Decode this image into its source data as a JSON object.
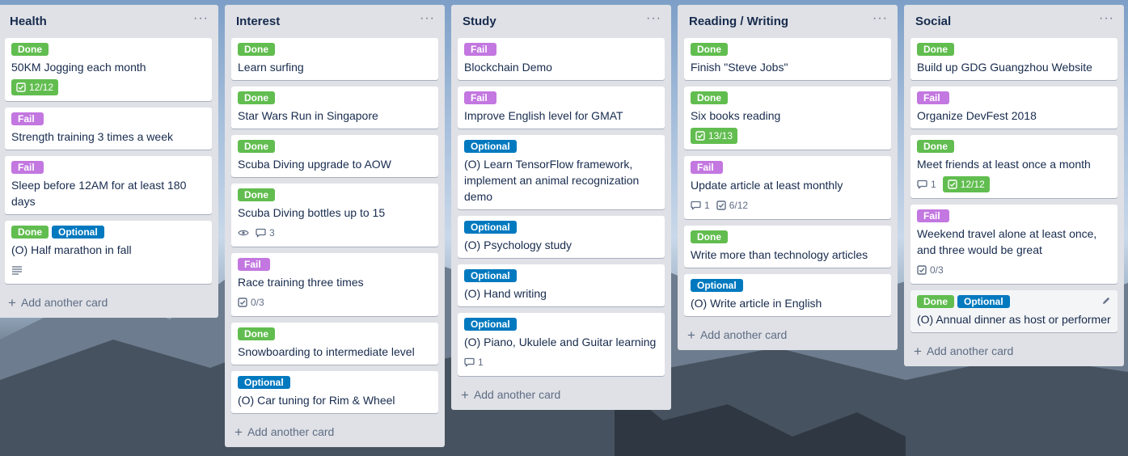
{
  "lists": [
    {
      "title": "Health",
      "add_label": "Add another card",
      "cards": [
        {
          "labels": [
            {
              "text": "Done",
              "kind": "done"
            }
          ],
          "title": "50KM Jogging each month",
          "checklist": "12/12"
        },
        {
          "labels": [
            {
              "text": "Fail",
              "kind": "fail"
            }
          ],
          "title": "Strength training 3 times a week"
        },
        {
          "labels": [
            {
              "text": "Fail",
              "kind": "fail"
            }
          ],
          "title": "Sleep before 12AM for at least 180 days"
        },
        {
          "labels": [
            {
              "text": "Done",
              "kind": "done"
            },
            {
              "text": "Optional",
              "kind": "optional"
            }
          ],
          "title": "(O) Half marathon in fall"
        }
      ]
    },
    {
      "title": "Interest",
      "add_label": "Add another card",
      "cards": [
        {
          "labels": [
            {
              "text": "Done",
              "kind": "done"
            }
          ],
          "title": "Learn surfing"
        },
        {
          "labels": [
            {
              "text": "Done",
              "kind": "done"
            }
          ],
          "title": "Star Wars Run in Singapore"
        },
        {
          "labels": [
            {
              "text": "Done",
              "kind": "done"
            }
          ],
          "title": "Scuba Diving upgrade to AOW"
        },
        {
          "labels": [
            {
              "text": "Done",
              "kind": "done"
            }
          ],
          "title": "Scuba Diving bottles up to 15",
          "comments": "3"
        },
        {
          "labels": [
            {
              "text": "Fail",
              "kind": "fail"
            }
          ],
          "title": "Race training three times",
          "checklist": "0/3"
        },
        {
          "labels": [
            {
              "text": "Done",
              "kind": "done"
            }
          ],
          "title": "Snowboarding to intermediate level"
        },
        {
          "labels": [
            {
              "text": "Optional",
              "kind": "optional"
            }
          ],
          "title": "(O) Car tuning for Rim & Wheel"
        }
      ]
    },
    {
      "title": "Study",
      "add_label": "Add another card",
      "cards": [
        {
          "labels": [
            {
              "text": "Fail",
              "kind": "fail"
            }
          ],
          "title": "Blockchain Demo"
        },
        {
          "labels": [
            {
              "text": "Fail",
              "kind": "fail"
            }
          ],
          "title": "Improve English level for GMAT"
        },
        {
          "labels": [
            {
              "text": "Optional",
              "kind": "optional"
            }
          ],
          "title": "(O) Learn TensorFlow framework, implement an animal recognization demo"
        },
        {
          "labels": [
            {
              "text": "Optional",
              "kind": "optional"
            }
          ],
          "title": "(O) Psychology study"
        },
        {
          "labels": [
            {
              "text": "Optional",
              "kind": "optional"
            }
          ],
          "title": "(O) Hand writing"
        },
        {
          "labels": [
            {
              "text": "Optional",
              "kind": "optional"
            }
          ],
          "title": "(O) Piano, Ukulele and Guitar learning",
          "comments": "1"
        }
      ]
    },
    {
      "title": "Reading / Writing",
      "add_label": "Add another card",
      "cards": [
        {
          "labels": [
            {
              "text": "Done",
              "kind": "done"
            }
          ],
          "title": "Finish \"Steve Jobs\""
        },
        {
          "labels": [
            {
              "text": "Done",
              "kind": "done"
            }
          ],
          "title": "Six books reading",
          "checklist": "13/13"
        },
        {
          "labels": [
            {
              "text": "Fail",
              "kind": "fail"
            }
          ],
          "title": "Update article at least monthly",
          "comments": "1",
          "checklist": "6/12"
        },
        {
          "labels": [
            {
              "text": "Done",
              "kind": "done"
            }
          ],
          "title": "Write more than technology articles"
        },
        {
          "labels": [
            {
              "text": "Optional",
              "kind": "optional"
            }
          ],
          "title": "(O) Write article in English"
        }
      ]
    },
    {
      "title": "Social",
      "add_label": "Add another card",
      "cards": [
        {
          "labels": [
            {
              "text": "Done",
              "kind": "done"
            }
          ],
          "title": "Build up GDG Guangzhou Website"
        },
        {
          "labels": [
            {
              "text": "Fail",
              "kind": "fail"
            }
          ],
          "title": "Organize DevFest 2018"
        },
        {
          "labels": [
            {
              "text": "Done",
              "kind": "done"
            }
          ],
          "title": "Meet friends at least once a month",
          "comments": "1",
          "checklist": "12/12"
        },
        {
          "labels": [
            {
              "text": "Fail",
              "kind": "fail"
            }
          ],
          "title": "Weekend travel alone at least once, and three would be great",
          "checklist": "0/3"
        },
        {
          "labels": [
            {
              "text": "Done",
              "kind": "done"
            },
            {
              "text": "Optional",
              "kind": "optional"
            }
          ],
          "title": "(O) Annual dinner as host or performer"
        }
      ]
    }
  ],
  "colors": {
    "done": "#61bd4f",
    "fail": "#c377e0",
    "optional": "#0079bf",
    "list_bg": "#dfe1e6",
    "title_text": "#172b4d"
  }
}
